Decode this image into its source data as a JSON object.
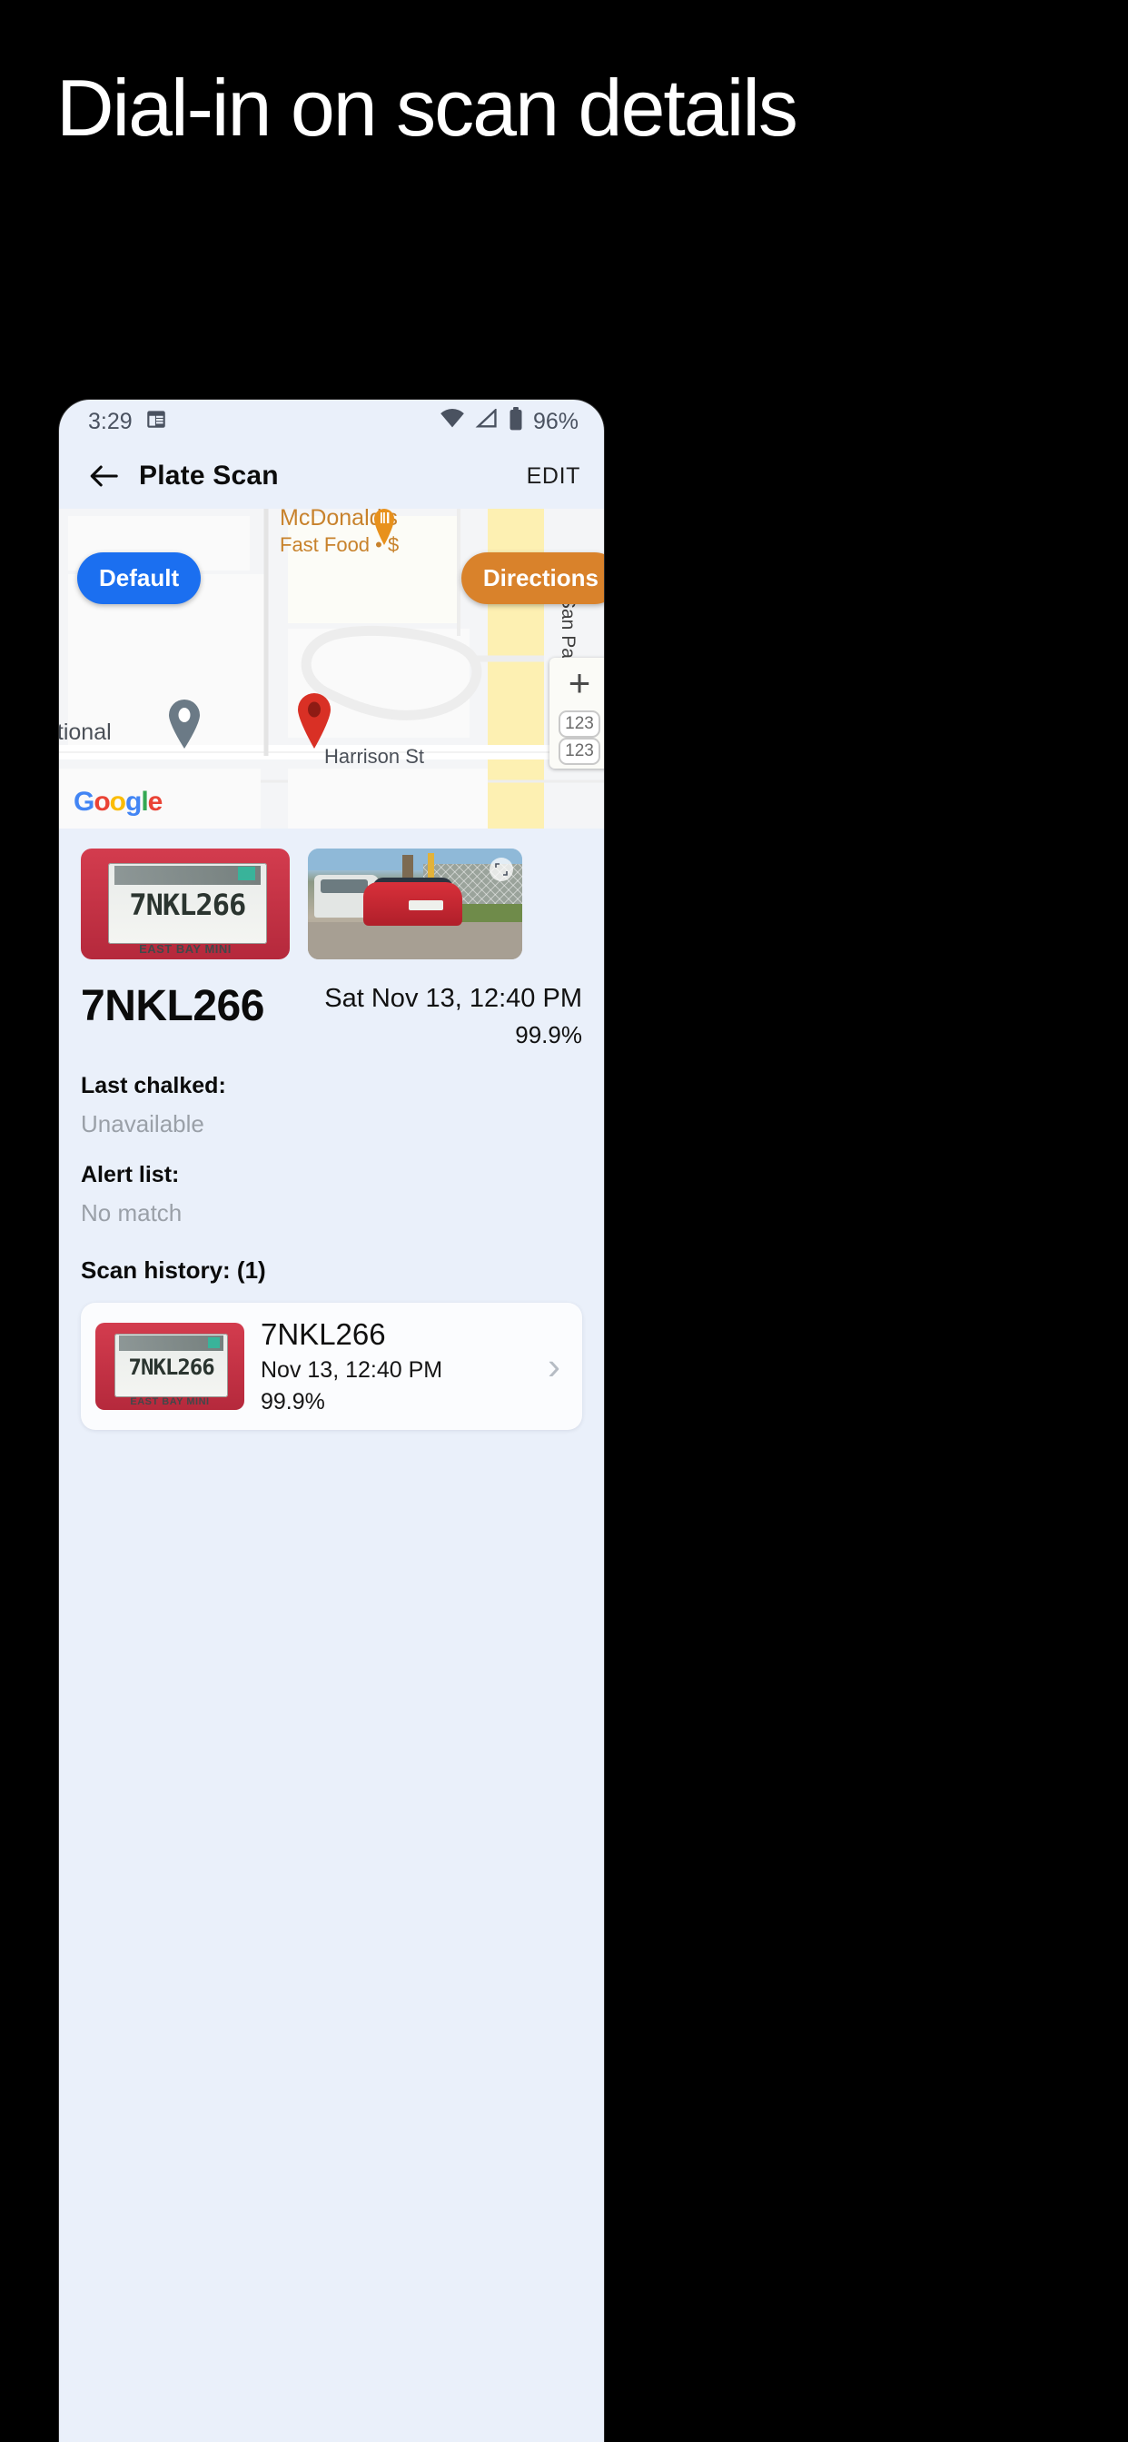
{
  "promo": {
    "headline": "Dial-in on scan details"
  },
  "status_bar": {
    "time": "3:29",
    "calendar_icon": "calendar-icon",
    "wifi_icon": "wifi-icon",
    "signal_icon": "signal-icon",
    "battery_icon": "battery-icon",
    "battery_level": "96%"
  },
  "app_bar": {
    "back_icon": "back-arrow-icon",
    "title": "Plate Scan",
    "edit_label": "EDIT"
  },
  "map": {
    "default_button": "Default",
    "directions_button": "Directions",
    "poi_name": "McDonald's",
    "poi_subtitle": "Fast Food • $",
    "street_label": "Harrison St",
    "street_label_vertical": "San Pab",
    "place_label_partial": "ational",
    "attribution": "Google",
    "zoom_in": "+",
    "route_shield_1": "123",
    "route_shield_2": "123",
    "accent_blue": "#1b6ff0",
    "accent_orange": "#d9822b",
    "marker_red": "#d93025"
  },
  "scan": {
    "plate_thumb_text": "7NKL266",
    "plate_thumb_frame_text": "EAST BAY MINI",
    "photo_expand_icon": "expand-icon",
    "plate_number": "7NKL266",
    "timestamp": "Sat Nov 13, 12:40 PM",
    "confidence": "99.9%",
    "last_chalked_label": "Last chalked:",
    "last_chalked_value": "Unavailable",
    "alert_list_label": "Alert list:",
    "alert_list_value": "No match",
    "scan_history_label": "Scan history: (1)"
  },
  "history": [
    {
      "thumb_text": "7NKL266",
      "thumb_frame_text": "EAST BAY MINI",
      "plate": "7NKL266",
      "date": "Nov 13, 12:40 PM",
      "confidence": "99.9%",
      "chevron": "›"
    }
  ]
}
